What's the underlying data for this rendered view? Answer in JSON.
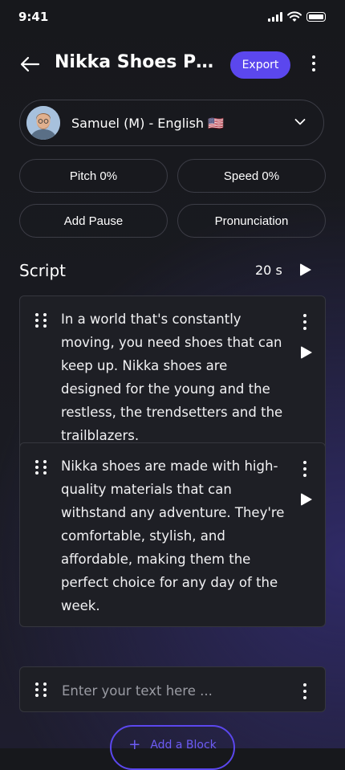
{
  "status_bar": {
    "time": "9:41"
  },
  "header": {
    "title": "Nikka Shoes Pro...",
    "export_label": "Export"
  },
  "voice": {
    "label": "Samuel (M) - English 🇺🇸"
  },
  "controls": {
    "pitch_label": "Pitch  0%",
    "speed_label": "Speed  0%",
    "pause_label": "Add Pause",
    "pronunciation_label": "Pronunciation"
  },
  "script": {
    "title": "Script",
    "duration": "20 s",
    "blocks": [
      {
        "text": "In a world that's constantly moving, you need shoes that can keep up. Nikka shoes are designed for the young and the restless, the trendsetters and the trailblazers."
      },
      {
        "text": "Nikka shoes are made with high-quality materials that can withstand any adventure. They're comfortable, stylish, and affordable, making them the perfect choice for any day of the week."
      }
    ],
    "input_placeholder": "Enter your text here ...",
    "add_block_label": "Add a Block"
  },
  "colors": {
    "accent": "#5b47ee",
    "background": "#17181c",
    "border": "#3c3d46"
  }
}
